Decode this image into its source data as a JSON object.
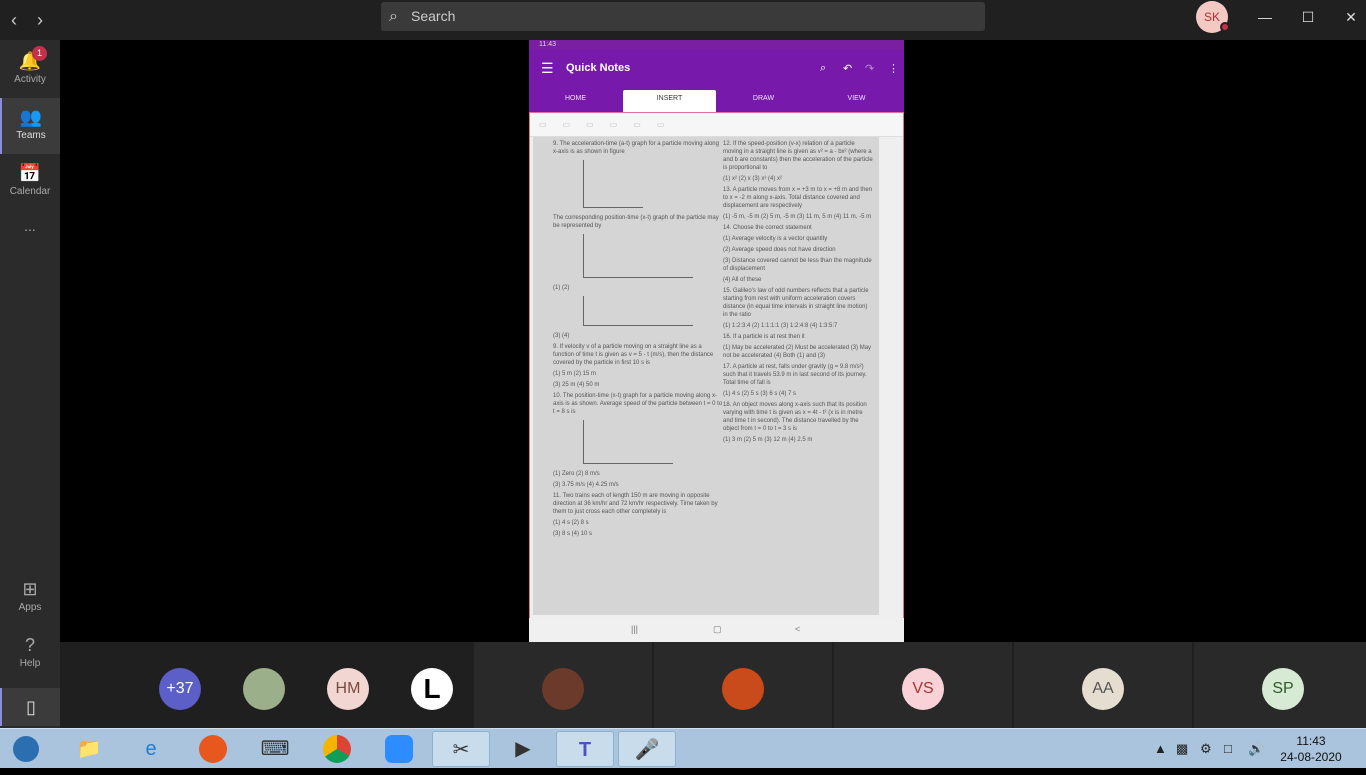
{
  "titlebar": {
    "search_placeholder": "Search",
    "user_initials": "SK",
    "back_icon": "‹",
    "forward_icon": "›",
    "minimize": "—",
    "maximize": "☐",
    "close": "✕"
  },
  "rail": {
    "items": [
      {
        "label": "Activity",
        "icon": "🔔",
        "badge": "1"
      },
      {
        "label": "Teams",
        "icon": "👥"
      },
      {
        "label": "Calendar",
        "icon": "📅"
      },
      {
        "label": "...",
        "icon": ""
      }
    ],
    "bottom": [
      {
        "label": "Apps",
        "icon": "⊞"
      },
      {
        "label": "Help",
        "icon": "?"
      },
      {
        "label": "",
        "icon": "▯"
      }
    ]
  },
  "shared_app": {
    "status_time": "11:43",
    "title": "Quick Notes",
    "tabs": [
      "HOME",
      "INSERT",
      "DRAW",
      "VIEW"
    ],
    "active_tab": "INSERT",
    "worksheet": {
      "left": [
        "9. The acceleration-time (a-t) graph for a particle moving along x-axis is as shown in figure",
        "The corresponding position-time (x-t) graph of the particle may be represented by",
        "(1)                (2)",
        "(3)                (4)",
        "9. If velocity v of a particle moving on a straight line as a function of time t is given as v = 5 - t (m/s), then the distance covered by the particle in first 10 s is",
        "(1) 5 m        (2) 15 m",
        "(3) 25 m       (4) 50 m",
        "10. The position-time (x-t) graph for a particle moving along x-axis is as shown. Average speed of the particle between t = 0 to t = 8 s is",
        "(1) Zero       (2) 8 m/s",
        "(3) 3.75 m/s   (4) 4.25 m/s",
        "11. Two trains each of length 150 m are moving in opposite direction at 36 km/hr and 72 km/hr respectively. Time taken by them to just cross each other completely is",
        "(1) 4 s        (2) 8 s",
        "(3) 8 s        (4) 10 s"
      ],
      "right": [
        "12. If the speed-position (v-x) relation of a particle moving in a straight line is given as v² = a - bx² (where a and b are constants) then the acceleration of the particle is proportional to",
        "(1) x²   (2) x   (3) x³   (4) x²",
        "13. A particle moves from x = +3 m to x = +8 m and then to x = -2 m along x-axis. Total distance covered and displacement are respectively",
        "(1) -5 m, -5 m   (2) 5 m, -5 m   (3) 11 m, 5 m   (4) 11 m, -5 m",
        "14. Choose the correct statement",
        "(1) Average velocity is a vector quantity",
        "(2) Average speed does not have direction",
        "(3) Distance covered cannot be less than the magnitude of displacement",
        "(4) All of these",
        "15. Galileo's law of odd numbers reflects that a particle starting from rest with uniform acceleration covers distance (in equal time intervals in straight line motion) in the ratio",
        "(1) 1:2:3:4   (2) 1:1:1:1   (3) 1:2:4:8   (4) 1:3:5:7",
        "16. If a particle is at rest then it",
        "(1) May be accelerated   (2) Must be accelerated   (3) May not be accelerated   (4) Both (1) and (3)",
        "17. A particle at rest, falls under gravity (g = 9.8 m/s²) such that it travels 53.9 m in last second of its journey. Total time of fall is",
        "(1) 4 s   (2) 5 s   (3) 6 s   (4) 7 s",
        "18. An object moves along x-axis such that its position varying with time t is given as x = 4t - t² (x is in metre and time t in second). The distance travelled by the object from t = 0 to t = 3 s is",
        "(1) 3 m   (2) 5 m   (3) 12 m   (4) 2.5 m"
      ]
    }
  },
  "participants": [
    {
      "initials": "+37",
      "bg": "#5b5fc7",
      "fg": "#ffffff"
    },
    {
      "initials": "",
      "bg": "#9bb08a",
      "fg": "#ffffff"
    },
    {
      "initials": "HM",
      "bg": "#f2d6d2",
      "fg": "#7a4a40"
    },
    {
      "initials": "L",
      "bg": "#ffffff",
      "fg": "#000000"
    },
    {
      "initials": "",
      "bg": "#6b3a2a",
      "fg": "#ffffff"
    },
    {
      "initials": "",
      "bg": "#c94a1a",
      "fg": "#ffffff"
    },
    {
      "initials": "VS",
      "bg": "#f8d2d6",
      "fg": "#a33"
    },
    {
      "initials": "AA",
      "bg": "#e4ddd0",
      "fg": "#555"
    },
    {
      "initials": "SP",
      "bg": "#d6ead4",
      "fg": "#2f5a2a"
    }
  ],
  "taskbar": {
    "time": "11:43",
    "date": "24-08-2020"
  }
}
